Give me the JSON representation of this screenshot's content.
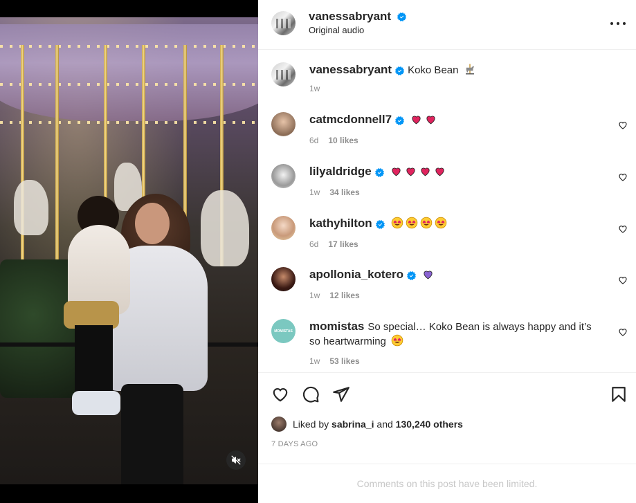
{
  "post": {
    "owner": "vanessabryant",
    "audio": "Original audio",
    "caption_text": "Koko Bean",
    "caption_time": "1w"
  },
  "comments": [
    {
      "username": "catmcdonnell7",
      "text": "",
      "emoji": "heart-red x2",
      "time": "6d",
      "likes": "10 likes"
    },
    {
      "username": "lilyaldridge",
      "text": "",
      "emoji": "heart-red x4",
      "time": "1w",
      "likes": "34 likes"
    },
    {
      "username": "kathyhilton",
      "text": "",
      "emoji": "heart-eyes x4",
      "time": "6d",
      "likes": "17 likes"
    },
    {
      "username": "apollonia_kotero",
      "text": "",
      "emoji": "heart-purple x1",
      "time": "1w",
      "likes": "12 likes"
    },
    {
      "username": "momistas",
      "text": "So special… Koko Bean is always happy and it’s so heartwarming",
      "emoji": "heart-eyes x1",
      "time": "1w",
      "likes": "53 likes",
      "avatar_text": "MOMISTAS"
    }
  ],
  "actions": {
    "liked_by_prefix": "Liked by",
    "liked_by_user": "sabrina_i",
    "liked_by_suffix": "and",
    "liked_by_count": "130,240 others",
    "timestamp": "7 DAYS AGO"
  },
  "footer": {
    "limited_text": "Comments on this post have been limited."
  },
  "colors": {
    "verified": "#0095f6",
    "heart_red": "#e0245e",
    "purple_heart": "#8a63d2",
    "muted": "#8e8e8e"
  }
}
